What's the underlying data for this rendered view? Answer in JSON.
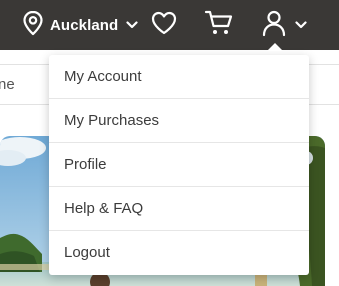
{
  "header": {
    "location_label": "Auckland",
    "icons": [
      "location-pin-icon",
      "chevron-down-icon",
      "heart-icon",
      "cart-icon",
      "user-icon",
      "chevron-down-icon"
    ]
  },
  "search": {
    "visible_fragment": "ne"
  },
  "account_menu": {
    "items": [
      {
        "label": "My Account"
      },
      {
        "label": "My Purchases"
      },
      {
        "label": "Profile"
      },
      {
        "label": "Help & FAQ"
      },
      {
        "label": "Logout"
      }
    ]
  },
  "colors": {
    "header_bg": "#3a3836",
    "menu_text": "#3c3c3c",
    "divider": "#e6e6e6"
  }
}
